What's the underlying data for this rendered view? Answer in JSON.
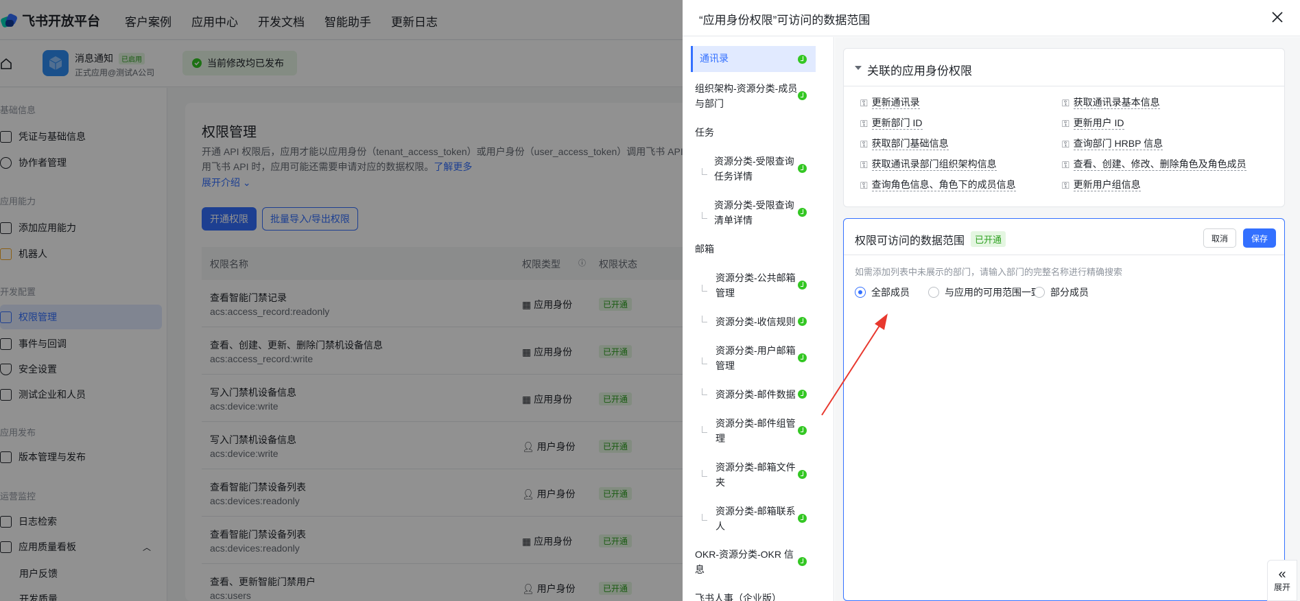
{
  "topbar": {
    "logo_title": "飞书开放平台",
    "nav": [
      "客户案例",
      "应用中心",
      "开发文档",
      "智能助手",
      "更新日志"
    ]
  },
  "appbar": {
    "app_name": "消息通知",
    "app_status": "已启用",
    "app_sub": "正式应用@测试A公司",
    "publish_text": "当前修改均已发布"
  },
  "sidebar": {
    "groups": [
      "基础信息",
      "应用能力",
      "开发配置",
      "应用发布",
      "运营监控"
    ],
    "items": [
      "凭证与基础信息",
      "协作者管理",
      "添加应用能力",
      "机器人",
      "权限管理",
      "事件与回调",
      "安全设置",
      "测试企业和人员",
      "版本管理与发布",
      "日志检索",
      "应用质量看板"
    ],
    "subitems": [
      "用户反馈",
      "开发质量"
    ]
  },
  "main": {
    "title": "权限管理",
    "desc_1": "开通 API 权限后，应用才能以应用身份（tenant_access_token）或用户身份（user_access_token）调用飞书 API；",
    "desc_2": "用飞书 API 时，应用可能还需要申请对应的数据权限。",
    "learn_more": "了解更多",
    "expand": "展开介绍",
    "btn_enable": "开通权限",
    "btn_batch": "批量导入/导出权限",
    "columns": [
      "权限名称",
      "权限类型",
      "权限状态"
    ],
    "rows": [
      {
        "name": "查看智能门禁记录",
        "code": "acs:access_record:readonly",
        "type": "应用身份",
        "status": "已开通"
      },
      {
        "name": "查看、创建、更新、删除门禁机设备信息",
        "code": "acs:access_record:write",
        "type": "应用身份",
        "status": "已开通"
      },
      {
        "name": "写入门禁机设备信息",
        "code": "acs:device:write",
        "type": "应用身份",
        "status": "已开通"
      },
      {
        "name": "写入门禁机设备信息",
        "code": "acs:device:write",
        "type": "用户身份",
        "status": "已开通"
      },
      {
        "name": "查看智能门禁设备列表",
        "code": "acs:devices:readonly",
        "type": "用户身份",
        "status": "已开通"
      },
      {
        "name": "查看智能门禁设备列表",
        "code": "acs:devices:readonly",
        "type": "应用身份",
        "status": "已开通"
      },
      {
        "name": "查看、更新智能门禁用户",
        "code": "acs:users",
        "type": "用户身份",
        "status": "已开通"
      }
    ]
  },
  "drawer": {
    "title": "“应用身份权限”可访问的数据范围",
    "left_items": [
      {
        "label": "通讯录",
        "check": true
      },
      {
        "label": "组织架构-资源分类-成员与部门",
        "check": true
      },
      {
        "label": "任务",
        "check": false
      },
      {
        "label": "资源分类-受限查询任务详情",
        "check": true
      },
      {
        "label": "资源分类-受限查询清单详情",
        "check": true
      },
      {
        "label": "邮箱",
        "check": false
      },
      {
        "label": "资源分类-公共邮箱管理",
        "check": true
      },
      {
        "label": "资源分类-收信规则",
        "check": true
      },
      {
        "label": "资源分类-用户邮箱管理",
        "check": true
      },
      {
        "label": "资源分类-邮件数据",
        "check": true
      },
      {
        "label": "资源分类-邮件组管理",
        "check": true
      },
      {
        "label": "资源分类-邮箱文件夹",
        "check": true
      },
      {
        "label": "资源分类-邮箱联系人",
        "check": true
      },
      {
        "label": "OKR-资源分类-OKR 信息",
        "check": true
      },
      {
        "label": "飞书人事（企业版）",
        "check": false
      }
    ],
    "assoc_title": "关联的应用身份权限",
    "assoc_perms": [
      "更新通讯录",
      "获取通讯录基本信息",
      "更新部门 ID",
      "更新用户 ID",
      "获取部门基础信息",
      "查询部门 HRBP 信息",
      "获取通讯录部门组织架构信息",
      "查看、创建、修改、删除角色及角色成员",
      "查询角色信息、角色下的成员信息",
      "更新用户组信息"
    ],
    "scope_title": "权限可访问的数据范围",
    "scope_badge": "已开通",
    "btn_cancel": "取消",
    "btn_save": "保存",
    "scope_hint": "如需添加列表中未展示的部门，请输入部门的完整名称进行精确搜索",
    "options": [
      "全部成员",
      "与应用的可用范围一致",
      "部分成员"
    ],
    "selected_option": "全部成员",
    "collapse_label": "展开"
  },
  "colors": {
    "primary": "#3370ff",
    "success": "#2ea121",
    "annotation_arrow": "#e8382e"
  }
}
